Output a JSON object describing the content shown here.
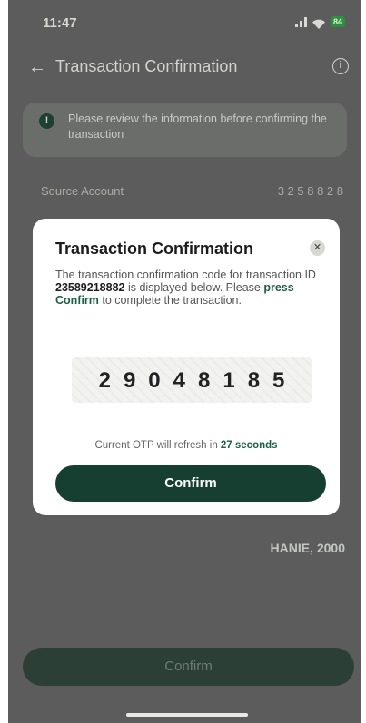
{
  "status_bar": {
    "time": "11:47",
    "battery": "84"
  },
  "header": {
    "title": "Transaction Confirmation"
  },
  "notice": {
    "text": "Please review the information before confirming the transaction"
  },
  "background": {
    "source_label": "Source Account",
    "source_value": "3 2 5 8 8 2 8",
    "amount": "HANIE, 2000",
    "confirm_label": "Confirm"
  },
  "modal": {
    "title": "Transaction Confirmation",
    "desc_before_id": "The transaction confirmation code for transaction ID ",
    "transaction_id": "23589218882",
    "desc_mid": " is displayed below. Please ",
    "desc_action": "press Confirm",
    "desc_after": " to complete the transaction.",
    "otp": "29048185",
    "refresh_prefix": "Current OTP will refresh in ",
    "refresh_seconds": "27 seconds",
    "confirm_label": "Confirm"
  },
  "colors": {
    "brand_green": "#163f31",
    "accent_green": "#1e5e44",
    "overlay": "#5b5c5b"
  }
}
